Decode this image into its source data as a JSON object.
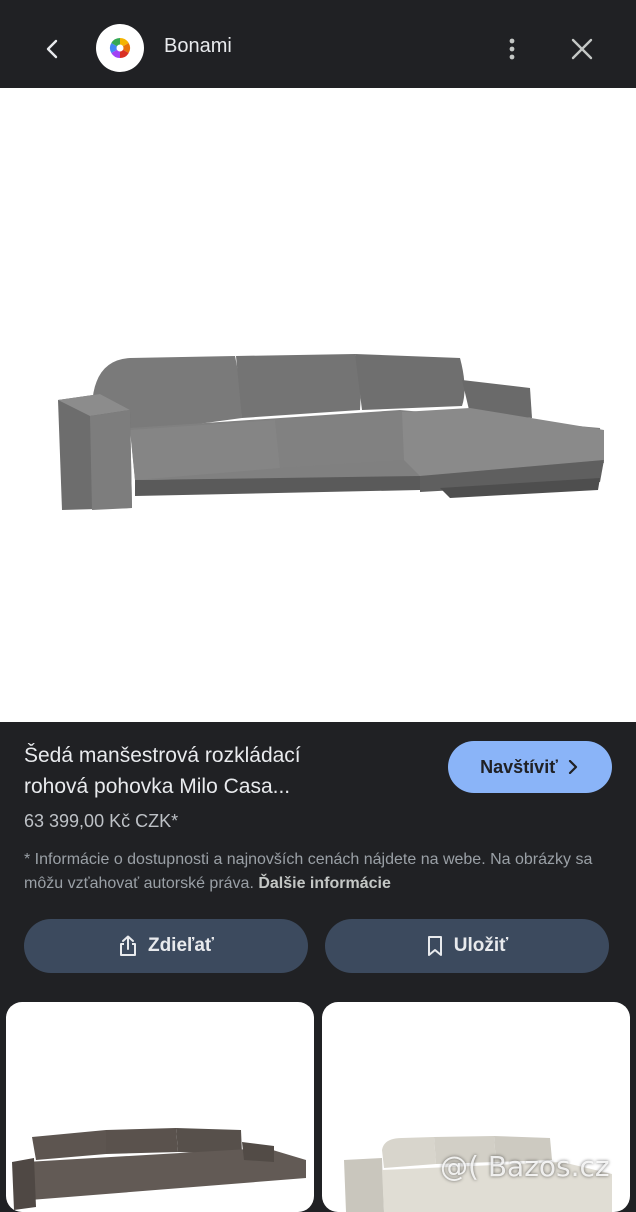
{
  "header": {
    "site_name": "Bonami",
    "back_icon": "chevron-left-icon",
    "menu_icon": "more-vert-icon",
    "close_icon": "close-icon"
  },
  "product": {
    "title_line1": "Šedá manšestrová rozkládací",
    "title_line2": "rohová pohovka Milo Casa...",
    "price": "63 399,00 Kč CZK*",
    "visit_label": "Navštíviť",
    "disclaimer_text": "* Informácie o dostupnosti a najnovších cenách nájdete na webe. Na obrázky sa môžu vzťahovať autorské práva.",
    "more_info_label": "Ďalšie informácie"
  },
  "actions": {
    "share_label": "Zdieľať",
    "save_label": "Uložiť"
  },
  "watermark": "@( Bazos.cz",
  "colors": {
    "background": "#202124",
    "accent": "#8ab4f8",
    "button_bg": "#3c4a5e",
    "sofa": "#6e6e6e"
  }
}
